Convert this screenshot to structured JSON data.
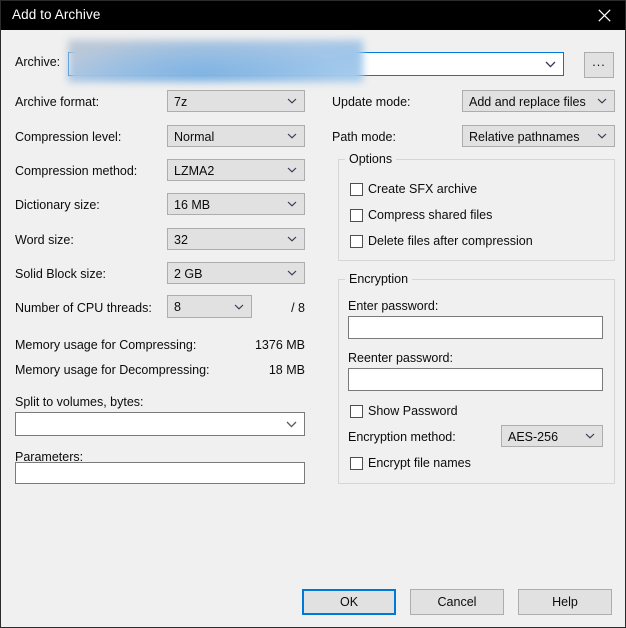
{
  "window": {
    "title": "Add to Archive",
    "close_icon": "close-icon"
  },
  "archive": {
    "label": "Archive:",
    "value": "",
    "placeholder": "",
    "redacted": true,
    "browse_label": "...",
    "dropdown_icon": "chevron-down-icon"
  },
  "left": {
    "archive_format": {
      "label": "Archive format:",
      "value": "7z"
    },
    "compression_level": {
      "label": "Compression level:",
      "value": "Normal"
    },
    "compression_method": {
      "label": "Compression method:",
      "value": "LZMA2"
    },
    "dictionary_size": {
      "label": "Dictionary size:",
      "value": "16 MB"
    },
    "word_size": {
      "label": "Word size:",
      "value": "32"
    },
    "solid_block_size": {
      "label": "Solid Block size:",
      "value": "2 GB"
    },
    "cpu_threads": {
      "label": "Number of CPU threads:",
      "value": "8",
      "suffix": "/ 8"
    },
    "mem_compress": {
      "label": "Memory usage for Compressing:",
      "value": "1376 MB"
    },
    "mem_decompress": {
      "label": "Memory usage for Decompressing:",
      "value": "18 MB"
    },
    "split_volumes": {
      "label": "Split to volumes, bytes:",
      "value": ""
    },
    "parameters": {
      "label": "Parameters:",
      "value": ""
    }
  },
  "right": {
    "update_mode": {
      "label": "Update mode:",
      "value": "Add and replace files"
    },
    "path_mode": {
      "label": "Path mode:",
      "value": "Relative pathnames"
    },
    "options": {
      "title": "Options",
      "items": [
        {
          "label": "Create SFX archive",
          "checked": false
        },
        {
          "label": "Compress shared files",
          "checked": false
        },
        {
          "label": "Delete files after compression",
          "checked": false
        }
      ]
    },
    "encryption": {
      "title": "Encryption",
      "enter_password": {
        "label": "Enter password:",
        "value": ""
      },
      "reenter_password": {
        "label": "Reenter password:",
        "value": ""
      },
      "show_password": {
        "label": "Show Password",
        "checked": false
      },
      "method": {
        "label": "Encryption method:",
        "value": "AES-256"
      },
      "encrypt_file_names": {
        "label": "Encrypt file names",
        "checked": false
      }
    }
  },
  "buttons": {
    "ok": "OK",
    "cancel": "Cancel",
    "help": "Help"
  },
  "colors": {
    "titlebar_bg": "#000000",
    "dialog_bg": "#f0f0f0",
    "accent": "#0078d7",
    "control_bg": "#e1e1e1",
    "control_border": "#adadad",
    "input_border": "#7a7a7a",
    "group_border": "#d6d6d6"
  }
}
